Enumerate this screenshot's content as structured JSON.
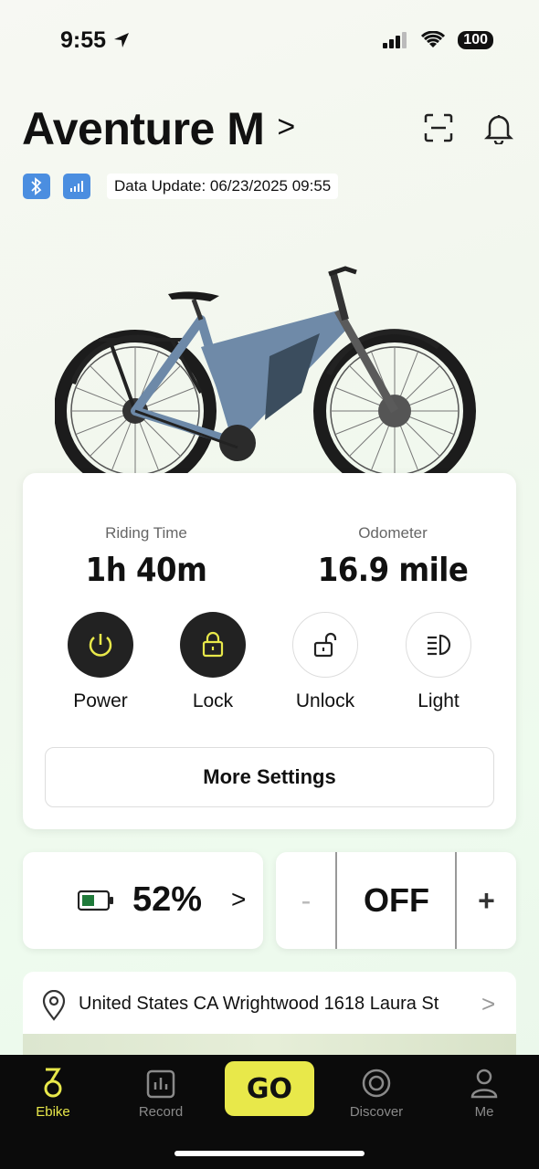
{
  "status_bar": {
    "time": "9:55",
    "battery": "100"
  },
  "header": {
    "title": "Aventure M",
    "data_update": "Data Update: 06/23/2025 09:55"
  },
  "stats": {
    "riding_time_label": "Riding Time",
    "riding_time_value": "1h  40m",
    "odometer_label": "Odometer",
    "odometer_value": "16.9 mile"
  },
  "controls": [
    {
      "label": "Power",
      "icon": "power-icon",
      "active": true
    },
    {
      "label": "Lock",
      "icon": "lock-icon",
      "active": true
    },
    {
      "label": "Unlock",
      "icon": "unlock-icon",
      "active": false
    },
    {
      "label": "Light",
      "icon": "headlight-icon",
      "active": false
    }
  ],
  "more_settings_label": "More Settings",
  "battery": {
    "percent": "52%",
    "level": 0.52,
    "color": "#1f7a3a"
  },
  "assist": {
    "minus": "-",
    "value": "OFF",
    "plus": "+"
  },
  "address": "United States CA Wrightwood 1618 Laura St",
  "tabs": {
    "ebike": "Ebike",
    "record": "Record",
    "go": "GO",
    "discover": "Discover",
    "me": "Me"
  },
  "colors": {
    "accent": "#e8e84a",
    "tab_active": "#e8e84a",
    "bluetooth_badge": "#4b8ee0"
  }
}
